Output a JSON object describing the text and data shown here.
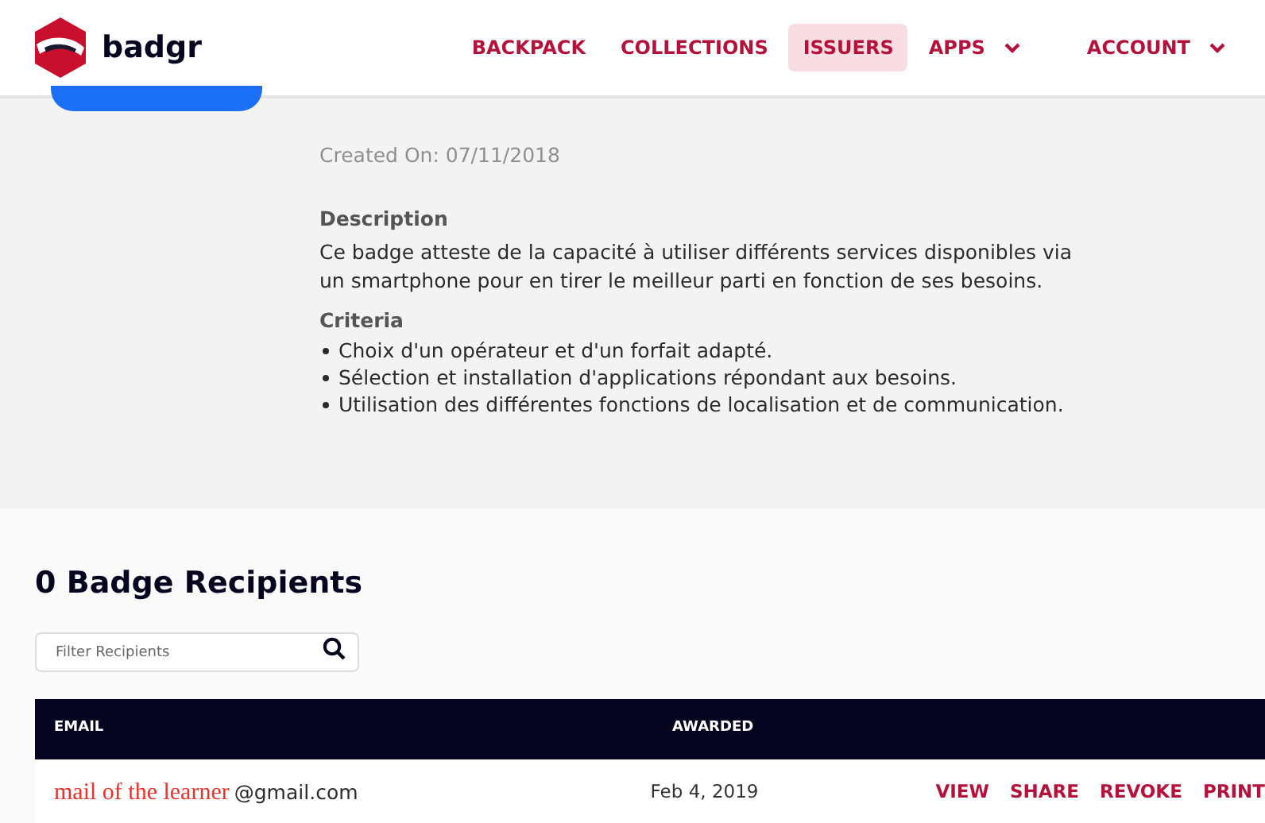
{
  "header": {
    "logo_text": "badgr",
    "nav": [
      {
        "label": "BACKPACK",
        "selected": false,
        "dropdown": false
      },
      {
        "label": "COLLECTIONS",
        "selected": false,
        "dropdown": false
      },
      {
        "label": "ISSUERS",
        "selected": true,
        "dropdown": false
      },
      {
        "label": "APPS",
        "selected": false,
        "dropdown": true
      },
      {
        "label": "ACCOUNT",
        "selected": false,
        "dropdown": true
      }
    ]
  },
  "badge": {
    "created_on": "Created On: 07/11/2018",
    "description_heading": "Description",
    "description": "Ce badge atteste de la capacité à utiliser différents services disponibles via un smartphone pour en tirer le meilleur parti en fonction de ses besoins.",
    "criteria_heading": "Criteria",
    "criteria": [
      "Choix d'un opérateur et d'un forfait adapté.",
      "Sélection et installation d'applications répondant aux besoins.",
      "Utilisation des différentes fonctions de localisation et de communication."
    ]
  },
  "recipients": {
    "title": "0 Badge Recipients",
    "filter": {
      "placeholder": "Filter Recipients"
    },
    "columns": [
      "EMAIL",
      "AWARDED"
    ],
    "rows": [
      {
        "email_annotation": "mail of the learner",
        "email_domain": "@gmail.com",
        "awarded": "Feb 4, 2019",
        "actions": [
          "VIEW",
          "SHARE",
          "REVOKE",
          "PRINT"
        ]
      }
    ]
  }
}
